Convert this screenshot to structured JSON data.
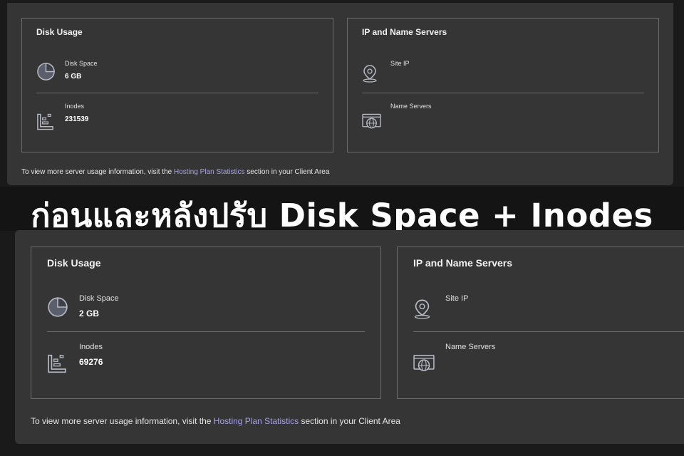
{
  "banner": {
    "title": "ก่อนและหลังปรับ Disk Space + Inodes"
  },
  "before": {
    "disk_usage": {
      "title": "Disk Usage",
      "disk_space": {
        "label": "Disk Space",
        "value": "6 GB",
        "icon": "pie-chart-icon"
      },
      "inodes": {
        "label": "Inodes",
        "value": "231539",
        "icon": "inodes-icon"
      }
    },
    "ip_servers": {
      "title": "IP and Name Servers",
      "site_ip": {
        "label": "Site IP",
        "icon": "location-pin-icon"
      },
      "name_servers": {
        "label": "Name Servers",
        "icon": "globe-browser-icon"
      }
    },
    "footnote": {
      "prefix": "To view more server usage information, visit the ",
      "link": "Hosting Plan Statistics",
      "suffix": " section in your Client Area"
    }
  },
  "after": {
    "disk_usage": {
      "title": "Disk Usage",
      "disk_space": {
        "label": "Disk Space",
        "value": "2 GB",
        "icon": "pie-chart-icon"
      },
      "inodes": {
        "label": "Inodes",
        "value": "69276",
        "icon": "inodes-icon"
      }
    },
    "ip_servers": {
      "title": "IP and Name Servers",
      "site_ip": {
        "label": "Site IP",
        "icon": "location-pin-icon"
      },
      "name_servers": {
        "label": "Name Servers",
        "icon": "globe-browser-icon"
      }
    },
    "footnote": {
      "prefix": "To view more server usage information, visit the ",
      "link": "Hosting Plan Statistics",
      "suffix": " section in your Client Area"
    }
  },
  "colors": {
    "panel": "#353535",
    "background": "#1a1a1a",
    "link": "#a9a3e8",
    "border": "#6b6b6b"
  }
}
